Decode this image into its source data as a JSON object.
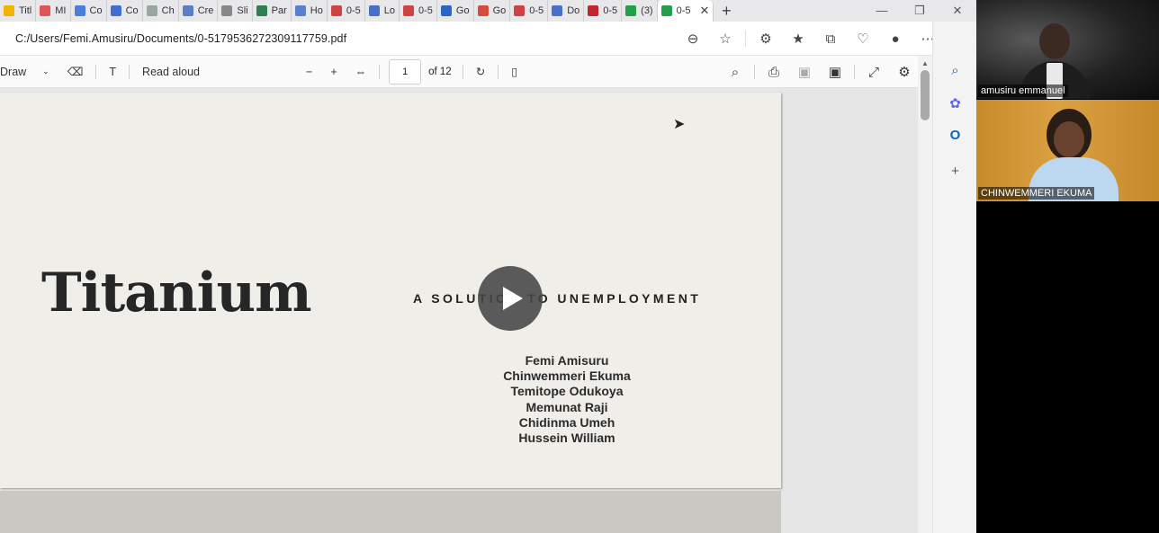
{
  "tabs": [
    {
      "label": "Titl",
      "color": "#f0b400"
    },
    {
      "label": "MI",
      "color": "#e05555"
    },
    {
      "label": "Co",
      "color": "#4a7fd8"
    },
    {
      "label": "Co",
      "color": "#3f6fd0"
    },
    {
      "label": "Ch",
      "color": "#9aa7a0"
    },
    {
      "label": "Cre",
      "color": "#5a7fc6"
    },
    {
      "label": "Sli",
      "color": "#888888"
    },
    {
      "label": "Par",
      "color": "#2f7f4f"
    },
    {
      "label": "Ho",
      "color": "#5b7fcf"
    },
    {
      "label": "0-5",
      "color": "#cc4444"
    },
    {
      "label": "Lo",
      "color": "#4a6fc8"
    },
    {
      "label": "0-5",
      "color": "#cc4444"
    },
    {
      "label": "Go",
      "color": "#2c67c7"
    },
    {
      "label": "Go",
      "color": "#d24b3b"
    },
    {
      "label": "0-5",
      "color": "#cc4444"
    },
    {
      "label": "Do",
      "color": "#4a6fc8"
    },
    {
      "label": "0-5",
      "color": "#c0262b"
    },
    {
      "label": "(3)",
      "color": "#22a04c"
    }
  ],
  "active_tab": {
    "label": "0-5",
    "color": "#22a04c"
  },
  "address": {
    "url": "C:/Users/Femi.Amusiru/Documents/0-5179536272309117759.pdf"
  },
  "pdf_toolbar": {
    "draw_label": "Draw",
    "read_aloud_label": "Read aloud",
    "page_current": "1",
    "page_total": "of 12"
  },
  "document": {
    "title": "Titanium",
    "subtitle": "A SOLUTION TO UNEMPLOYMENT",
    "names": [
      "Femi Amisuru",
      "Chinwemmeri Ekuma",
      "Temitope Odukoya",
      "Memunat Raji",
      "Chidinma Umeh",
      "Hussein William"
    ]
  },
  "participants": [
    {
      "name": "amusiru emmanuel"
    },
    {
      "name": "CHINWEMMERI EKUMA"
    }
  ]
}
